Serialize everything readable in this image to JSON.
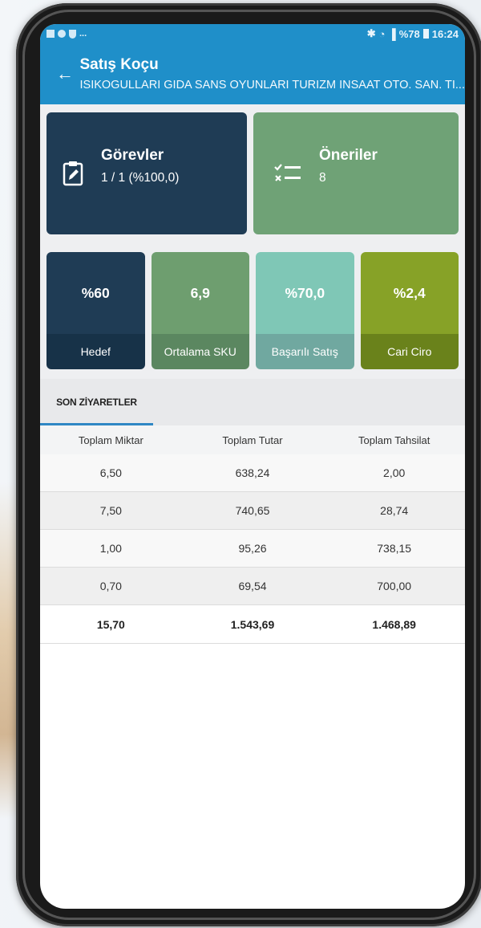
{
  "status_bar": {
    "left_text": "...",
    "battery": "%78",
    "time": "16:24"
  },
  "app_bar": {
    "title": "Satış Koçu",
    "subtitle": "ISIKOGULLARI GIDA SANS OYUNLARI TURIZM INSAAT OTO. SAN. TI..."
  },
  "cards": [
    {
      "title": "Görevler",
      "value": "1 / 1 (%100,0)",
      "icon": "clipboard-edit-icon",
      "color": "#1f3c55"
    },
    {
      "title": "Öneriler",
      "value": "8",
      "icon": "checklist-icon",
      "color": "#6fa276"
    }
  ],
  "metrics": [
    {
      "value": "%60",
      "label": "Hedef",
      "color": "#1f3c55"
    },
    {
      "value": "6,9",
      "label": "Ortalama SKU",
      "color": "#6e9e6f"
    },
    {
      "value": "%70,0",
      "label": "Başarılı Satış",
      "color": "#7fc7b6"
    },
    {
      "value": "%2,4",
      "label": "Cari Ciro",
      "color": "#87a227"
    }
  ],
  "tabs": [
    {
      "label": "SON ZİYARETLER",
      "active": true
    }
  ],
  "table": {
    "headers": [
      "Toplam Miktar",
      "Toplam Tutar",
      "Toplam Tahsilat"
    ],
    "rows": [
      [
        "6,50",
        "638,24",
        "2,00"
      ],
      [
        "7,50",
        "740,65",
        "28,74"
      ],
      [
        "1,00",
        "95,26",
        "738,15"
      ],
      [
        "0,70",
        "69,54",
        "700,00"
      ]
    ],
    "total": [
      "15,70",
      "1.543,69",
      "1.468,89"
    ]
  },
  "colors": {
    "primary": "#1f8fc9",
    "tab_indicator": "#2f87c4"
  }
}
